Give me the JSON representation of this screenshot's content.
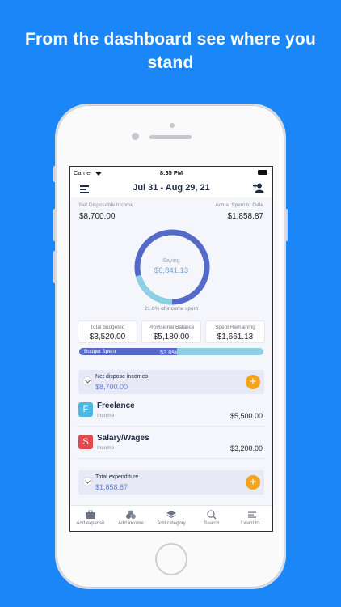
{
  "headline": {
    "line1": "From the dashboard see where you",
    "line2": "stand"
  },
  "status": {
    "carrier": "Carrier",
    "time": "8:35 PM"
  },
  "nav": {
    "date_range": "Jul 31 - Aug 29, 21"
  },
  "summary": {
    "net_label": "Net Disposable Income",
    "net_value": "$8,700.00",
    "spent_label": "Actual Spent to Date",
    "spent_value": "$1,858.87"
  },
  "donut": {
    "label": "Saving",
    "value": "$6,841.13",
    "caption": "21.0% of income spent",
    "spent_fraction": 0.21
  },
  "cards": [
    {
      "label": "Total budgeted",
      "value": "$3,520.00"
    },
    {
      "label": "Provisional Balance",
      "value": "$5,180.00"
    },
    {
      "label": "Spent Remaining",
      "value": "$1,661.13"
    }
  ],
  "budget_bar": {
    "label": "Budget Spent",
    "percent_text": "53.0%",
    "fraction": 0.53
  },
  "income_group": {
    "title": "Net dispose incomes",
    "amount": "$8,700.00"
  },
  "income_rows": [
    {
      "badge": "F",
      "name": "Freelance",
      "sub": "Income",
      "amount": "$5,500.00"
    },
    {
      "badge": "S",
      "name": "Salary/Wages",
      "sub": "Income",
      "amount": "$3,200.00"
    }
  ],
  "expense_group": {
    "title": "Total expenditure",
    "amount": "$1,858.87"
  },
  "tabs": [
    {
      "label": "Add expense"
    },
    {
      "label": "Add income"
    },
    {
      "label": "Add category"
    },
    {
      "label": "Search"
    },
    {
      "label": "I want to..."
    }
  ],
  "colors": {
    "background": "#1a86f7",
    "accent": "#5469c8",
    "saving_ring": "#8dcfe3",
    "plus": "#f5a31a",
    "badge_f": "#4bb9e4",
    "badge_s": "#e9474e"
  },
  "icons": [
    "menu-icon",
    "add-user-icon",
    "chevron-down-icon",
    "plus-icon",
    "briefcase-icon",
    "coins-icon",
    "layers-icon",
    "search-icon",
    "list-icon"
  ]
}
